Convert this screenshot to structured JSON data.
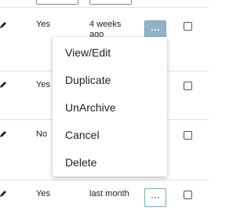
{
  "rows": [
    {
      "field1": "Yes",
      "field2": "4 weeks ago"
    },
    {
      "field1": "Yes",
      "field2": ""
    },
    {
      "field1": "No",
      "field2": ""
    },
    {
      "field1": "Yes",
      "field2": "last month"
    }
  ],
  "menu": {
    "items": [
      "View/Edit",
      "Duplicate",
      "UnArchive",
      "Cancel",
      "Delete"
    ]
  },
  "icons": {
    "edit": "pencil-icon",
    "more": "ellipsis-icon"
  },
  "colors": {
    "button_active_bg": "#8fb5c4",
    "button_border": "#7aa7bb"
  }
}
